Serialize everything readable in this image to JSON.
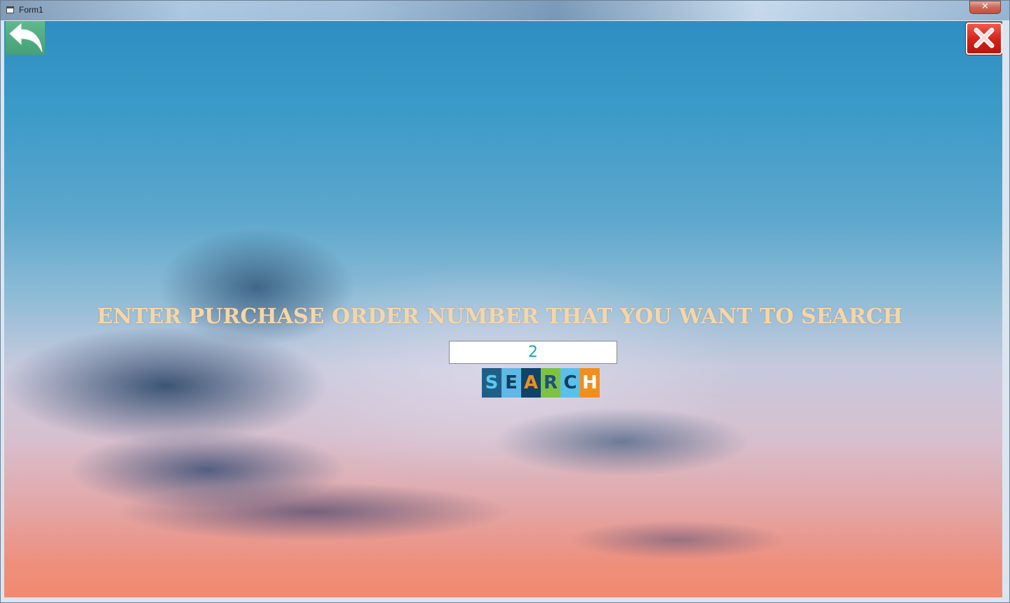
{
  "window": {
    "title": "Form1",
    "close_glyph": "✕"
  },
  "icons": {
    "back": "back-arrow-icon",
    "close": "close-x-icon",
    "window": "form-window-icon"
  },
  "colors": {
    "prompt_text": "#f5d6a8",
    "input_text": "#1ba6b8",
    "back_button_bg": "#4fab82",
    "close_button_bg": "#d3221a"
  },
  "main": {
    "prompt": "ENTER PURCHASE ORDER NUMBER THAT YOU WANT TO SEARCH",
    "po_number_value": "2",
    "search_tiles": [
      {
        "letter": "S",
        "bg": "#1f5f86",
        "fg": "#5ec8f0"
      },
      {
        "letter": "E",
        "bg": "#5fb8e6",
        "fg": "#0f3d5e"
      },
      {
        "letter": "A",
        "bg": "#0f4468",
        "fg": "#f28e1c"
      },
      {
        "letter": "R",
        "bg": "#7dc243",
        "fg": "#1f4f80"
      },
      {
        "letter": "C",
        "bg": "#59c0ea",
        "fg": "#0f3d5e"
      },
      {
        "letter": "H",
        "bg": "#f28e1c",
        "fg": "#ffffff"
      }
    ]
  }
}
